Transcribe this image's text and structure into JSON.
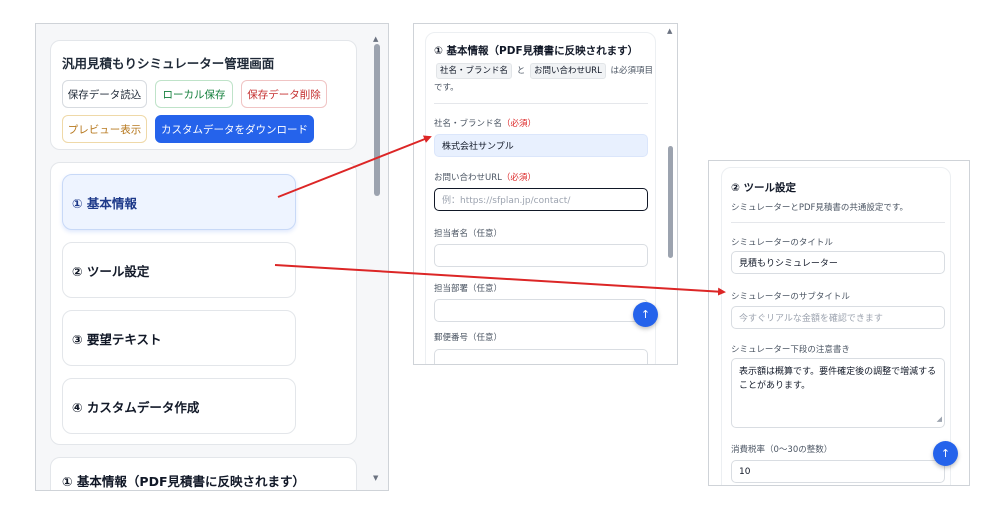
{
  "left": {
    "admin_title": "汎用見積もりシミュレーター管理画面",
    "buttons": {
      "load": "保存データ読込",
      "local_save": "ローカル保存",
      "delete": "保存データ削除",
      "preview": "プレビュー表示",
      "download": "カスタムデータをダウンロード"
    },
    "nav": [
      {
        "label": "① 基本情報",
        "active": true
      },
      {
        "label": "② ツール設定",
        "active": false
      },
      {
        "label": "③ 要望テキスト",
        "active": false
      },
      {
        "label": "④ カスタムデータ作成",
        "active": false
      }
    ],
    "section_title": "① 基本情報（PDF見積書に反映されます）"
  },
  "middle": {
    "heading": "① 基本情報（PDF見積書に反映されます）",
    "note_chip_1": "社名・ブランド名",
    "note_and": "と",
    "note_chip_2": "お問い合わせURL",
    "note_tail": "は必須項目です。",
    "required_mark": "（必須）",
    "fields": [
      {
        "label": "社名・ブランド名",
        "value": "株式会社サンプル",
        "required": true
      },
      {
        "label": "お問い合わせURL",
        "placeholder": "例：https://sfplan.jp/contact/",
        "required": true
      },
      {
        "label": "担当者名（任意）",
        "value": ""
      },
      {
        "label": "担当部署（任意）",
        "value": ""
      },
      {
        "label": "郵便番号（任意）",
        "value": ""
      }
    ]
  },
  "right": {
    "heading": "② ツール設定",
    "subtitle": "シミュレーターとPDF見積書の共通設定です。",
    "fields": [
      {
        "label": "シミュレーターのタイトル",
        "value": "見積もりシミュレーター"
      },
      {
        "label": "シミュレーターのサブタイトル",
        "placeholder": "今すぐリアルな金額を確認できます"
      },
      {
        "label": "シミュレーター下段の注意書き",
        "value": "表示額は概算です。要件確定後の調整で増減することがあります。"
      },
      {
        "label": "消費税率（0〜30の整数）",
        "value": "10"
      }
    ]
  },
  "icons": {
    "fab": "arrow-up-icon",
    "scroll_up": "triangle-up-icon",
    "scroll_down": "triangle-down-icon"
  },
  "colors": {
    "primary": "#2563eb",
    "annotation_arrow": "#dc2626",
    "required": "#dc2626",
    "save_green": "#15803d",
    "delete_red": "#c53030",
    "preview_amber": "#b7791f"
  }
}
